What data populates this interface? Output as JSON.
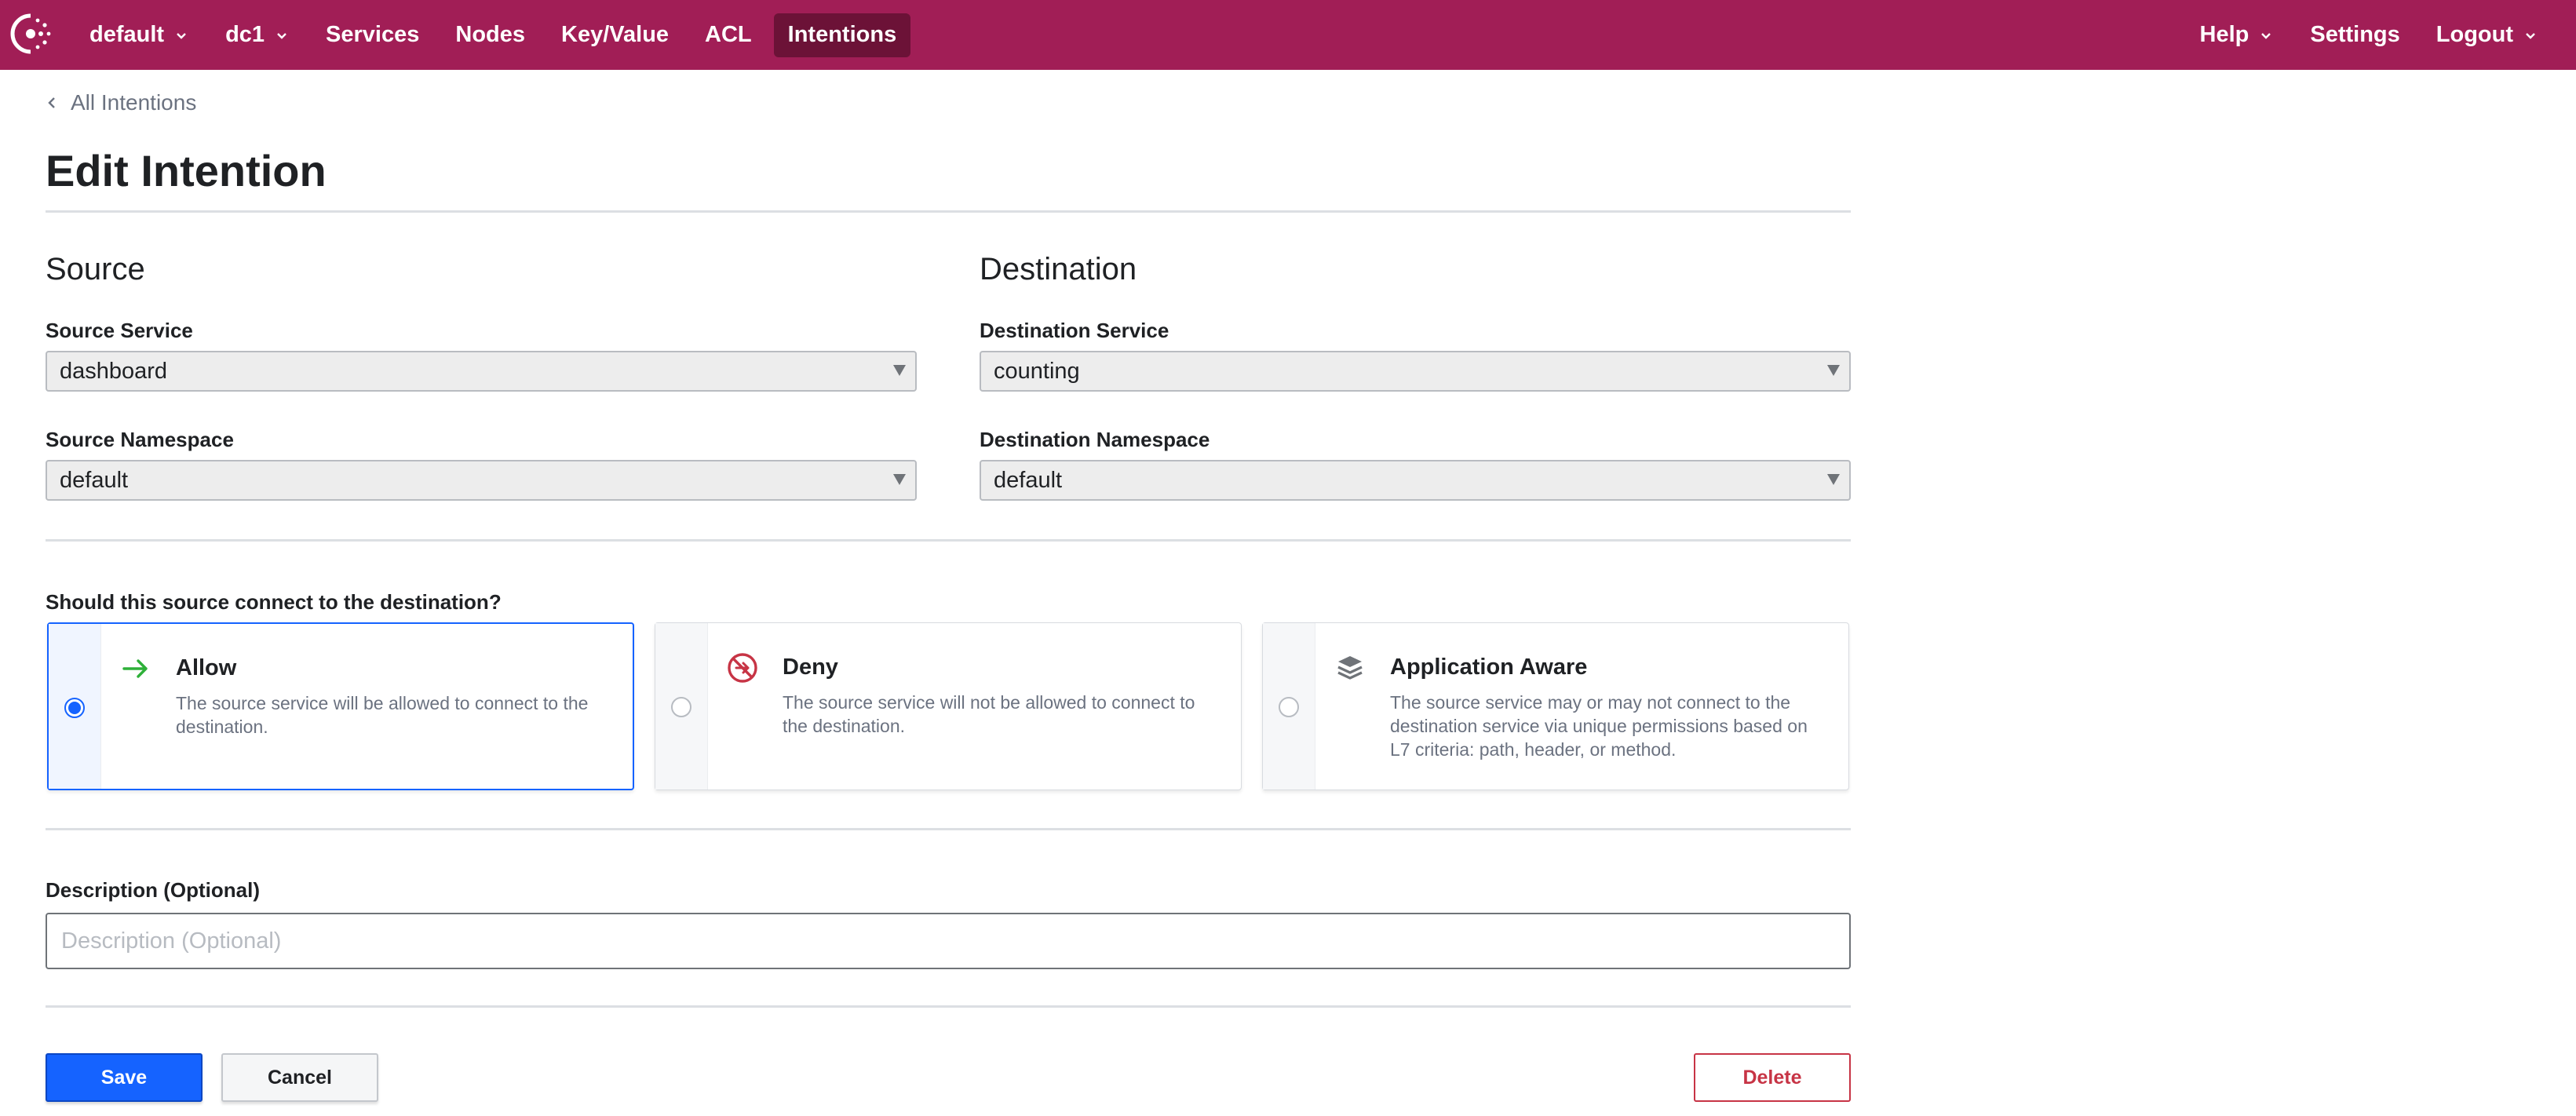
{
  "nav": {
    "namespace_label": "default",
    "datacenter_label": "dc1",
    "items": [
      {
        "label": "Services"
      },
      {
        "label": "Nodes"
      },
      {
        "label": "Key/Value"
      },
      {
        "label": "ACL"
      },
      {
        "label": "Intentions",
        "active": true
      }
    ],
    "help_label": "Help",
    "settings_label": "Settings",
    "logout_label": "Logout"
  },
  "breadcrumb": {
    "label": "All Intentions"
  },
  "page": {
    "title": "Edit Intention"
  },
  "source": {
    "heading": "Source",
    "service_label": "Source Service",
    "service_value": "dashboard",
    "namespace_label": "Source Namespace",
    "namespace_value": "default"
  },
  "destination": {
    "heading": "Destination",
    "service_label": "Destination Service",
    "service_value": "counting",
    "namespace_label": "Destination Namespace",
    "namespace_value": "default"
  },
  "action": {
    "question": "Should this source connect to the destination?",
    "options": [
      {
        "title": "Allow",
        "description": "The source service will be allowed to connect to the destination.",
        "selected": true,
        "icon": "arrow-right-icon"
      },
      {
        "title": "Deny",
        "description": "The source service will not be allowed to connect to the destination.",
        "selected": false,
        "icon": "deny-icon"
      },
      {
        "title": "Application Aware",
        "description": "The source service may or may not connect to the destination service via unique permissions based on L7 criteria: path, header, or method.",
        "selected": false,
        "icon": "layers-icon"
      }
    ]
  },
  "description": {
    "label": "Description (Optional)",
    "placeholder": "Description (Optional)",
    "value": ""
  },
  "buttons": {
    "save": "Save",
    "cancel": "Cancel",
    "delete": "Delete"
  },
  "colors": {
    "brand_nav": "#a11e56",
    "nav_active": "#6c1237",
    "primary": "#1563ff",
    "allow_green": "#2eb039",
    "deny_red": "#c73445",
    "delete_red": "#c73445"
  }
}
